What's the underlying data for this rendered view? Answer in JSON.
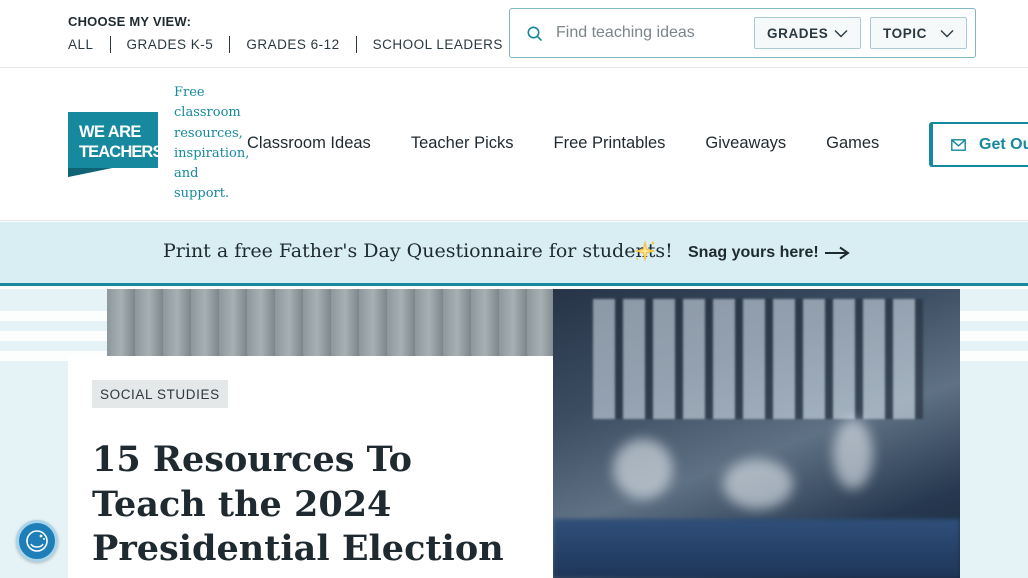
{
  "top_bar": {
    "view_label": "CHOOSE MY VIEW:",
    "view_links": [
      "ALL",
      "GRADES K-5",
      "GRADES 6-12",
      "SCHOOL LEADERS"
    ],
    "search": {
      "placeholder": "Find teaching ideas",
      "value": "",
      "grades_select": "GRADES",
      "topic_select": "TOPIC"
    }
  },
  "header": {
    "logo_text": "WE ARE TEACHERS",
    "tagline": "Free classroom resources, inspiration, and support.",
    "nav_items": [
      "Classroom Ideas",
      "Teacher Picks",
      "Free Printables",
      "Giveaways",
      "Games"
    ],
    "cta_label": "Get Ou"
  },
  "promo": {
    "text": "Print a free Father's Day Questionnaire for students!",
    "link_label": "Snag yours here!"
  },
  "article": {
    "category": "SOCIAL STUDIES",
    "title": "15 Resources To Teach the 2024 Presidential Election"
  },
  "colors": {
    "brand_teal": "#16899f",
    "promo_bg": "#d9eef3",
    "text_dark": "#1f2a30"
  },
  "icons": [
    "search-icon",
    "chevron-down-icon",
    "mail-icon",
    "sparkle-icon",
    "arrow-right-icon",
    "accessibility-widget-icon"
  ]
}
